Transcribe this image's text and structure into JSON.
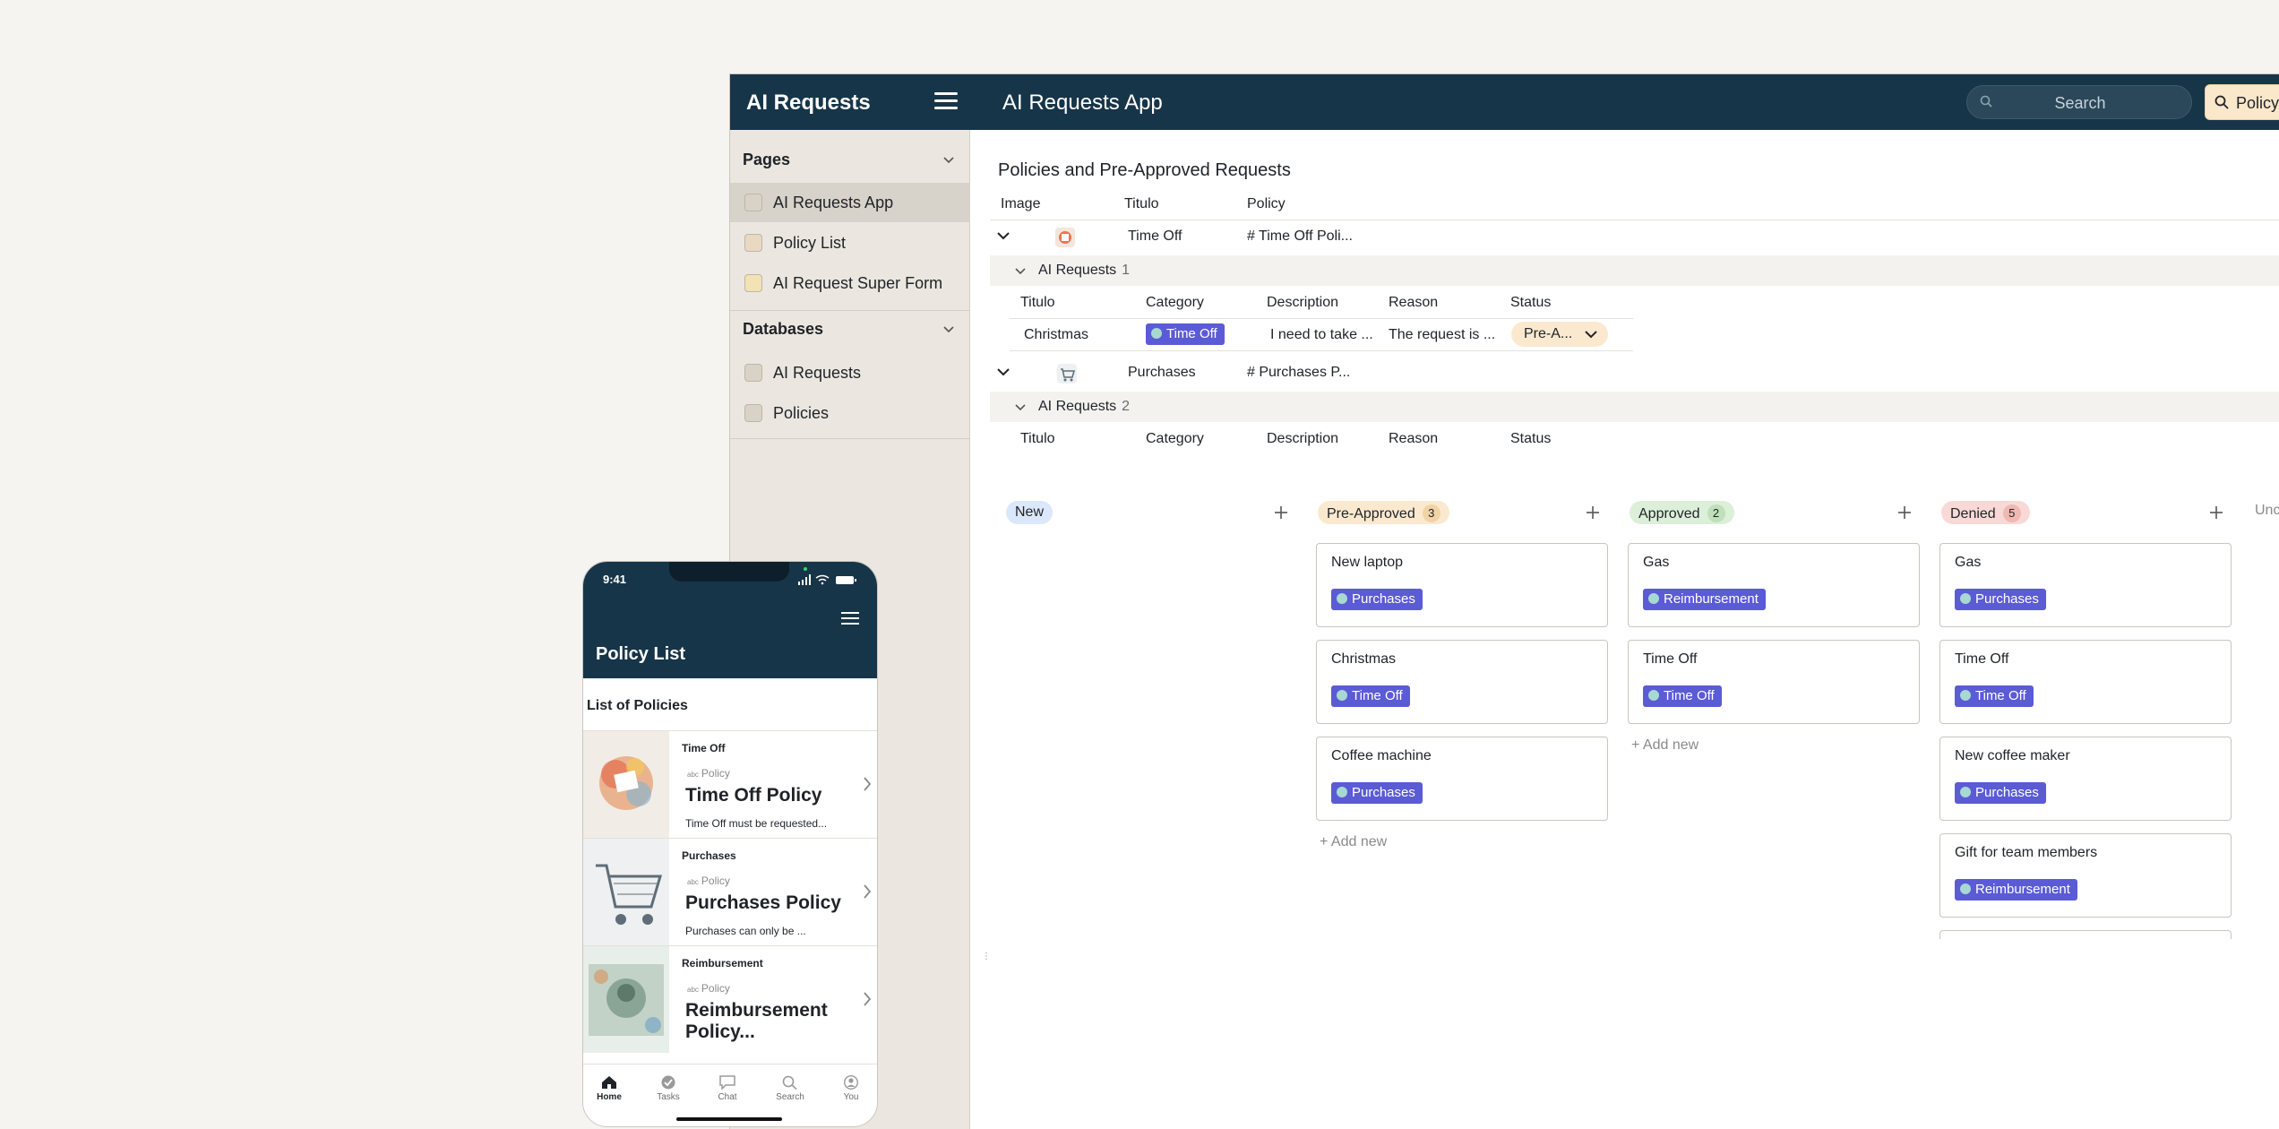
{
  "topbar": {
    "brand": "AI Requests",
    "app_title": "AI Requests App",
    "search_placeholder": "Search",
    "policy_button": "Policy"
  },
  "sidebar": {
    "pages_heading": "Pages",
    "pages": [
      {
        "label": "AI Requests App",
        "icon": "app-icon",
        "active": true
      },
      {
        "label": "Policy List",
        "icon": "list-page-icon"
      },
      {
        "label": "AI Request Super Form",
        "icon": "form-pencil-icon"
      }
    ],
    "databases_heading": "Databases",
    "databases": [
      {
        "label": "AI Requests",
        "icon": "table-icon"
      },
      {
        "label": "Policies",
        "icon": "table-icon"
      }
    ]
  },
  "table": {
    "title": "Policies and Pre-Approved Requests",
    "headers": [
      "Image",
      "Titulo",
      "Policy"
    ],
    "sub_headers": [
      "Titulo",
      "Category",
      "Description",
      "Reason",
      "Status"
    ],
    "groups": [
      {
        "titulo": "Time Off",
        "policy": "# Time Off Poli...",
        "sub_label": "AI Requests",
        "sub_count": "1",
        "rows": [
          {
            "titulo": "Christmas",
            "category": "Time Off",
            "description": "I need to take ...",
            "reason": "The request is ...",
            "status": "Pre-A..."
          }
        ]
      },
      {
        "titulo": "Purchases",
        "policy": "# Purchases P...",
        "sub_label": "AI Requests",
        "sub_count": "2",
        "rows": []
      }
    ]
  },
  "kanban": {
    "add_new": "+ Add new",
    "columns": [
      {
        "label": "New",
        "count": "",
        "bg": "#dbe7fb",
        "color": "#1f2328",
        "cards": []
      },
      {
        "label": "Pre-Approved",
        "count": "3",
        "bg": "#fbe9cf",
        "badge": "#f1d3a6",
        "cards": [
          {
            "title": "New laptop",
            "tag": "Purchases"
          },
          {
            "title": "Christmas",
            "tag": "Time Off"
          },
          {
            "title": "Coffee machine",
            "tag": "Purchases"
          }
        ]
      },
      {
        "label": "Approved",
        "count": "2",
        "bg": "#dcefd9",
        "badge": "#bfe0b9",
        "cards": [
          {
            "title": "Gas",
            "tag": "Reimbursement"
          },
          {
            "title": "Time Off",
            "tag": "Time Off"
          }
        ]
      },
      {
        "label": "Denied",
        "count": "5",
        "bg": "#f8d9d6",
        "badge": "#f0b8b2",
        "cards": [
          {
            "title": "Gas",
            "tag": "Purchases"
          },
          {
            "title": "Time Off",
            "tag": "Time Off"
          },
          {
            "title": "New coffee maker",
            "tag": "Purchases"
          },
          {
            "title": "Gift for team members",
            "tag": "Reimbursement"
          }
        ]
      }
    ],
    "overflow_label": "Unc"
  },
  "phone": {
    "time": "9:41",
    "title": "Policy List",
    "section": "List of Policies",
    "policy_label": "Policy",
    "abc": "abc",
    "items": [
      {
        "category": "Time Off",
        "name": "Time Off Policy",
        "desc": "Time Off must be requested..."
      },
      {
        "category": "Purchases",
        "name": "Purchases Policy",
        "desc": "Purchases can only be ..."
      },
      {
        "category": "Reimbursement",
        "name": "Reimbursement Policy...",
        "desc": ""
      }
    ],
    "tabs": [
      {
        "label": "Home",
        "icon": "home-icon",
        "active": true
      },
      {
        "label": "Tasks",
        "icon": "check-circle-icon"
      },
      {
        "label": "Chat",
        "icon": "chat-icon"
      },
      {
        "label": "Search",
        "icon": "search-icon"
      },
      {
        "label": "You",
        "icon": "user-icon"
      }
    ]
  },
  "colors": {
    "navy": "#173548",
    "tag_purple": "#5b5bd6",
    "sidebar_bg": "#ebe7e0"
  }
}
